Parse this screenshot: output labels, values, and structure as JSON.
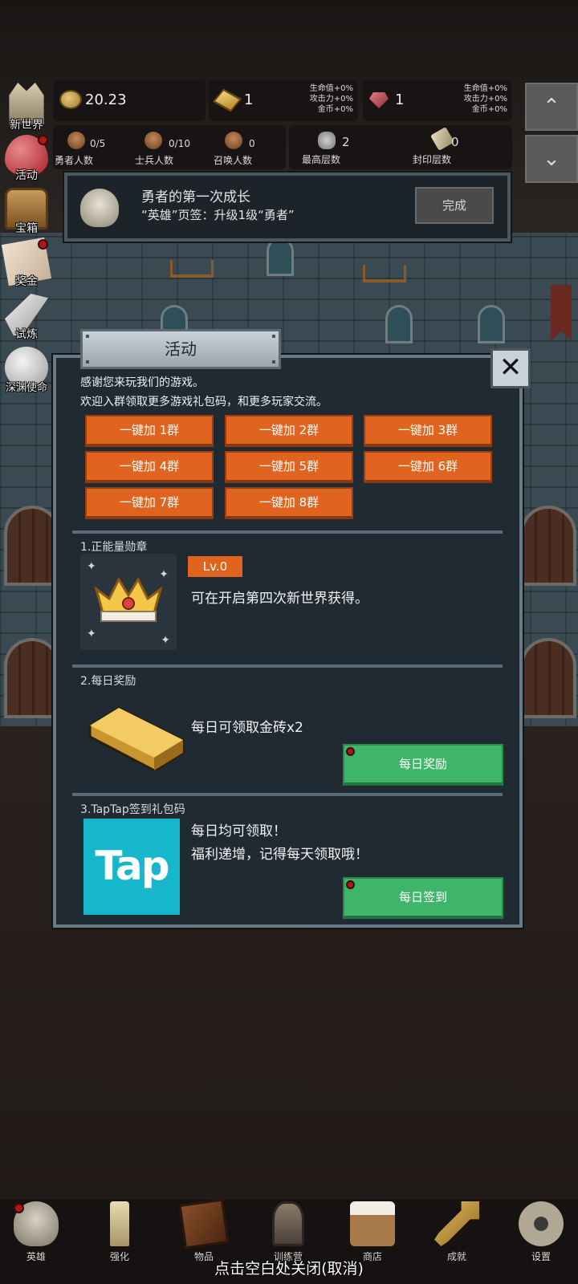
{
  "resources": {
    "gold": "20.23",
    "gold_bars": "1",
    "gems": "1",
    "gold_bars_bonus": [
      "生命值+0%",
      "攻击力+0%",
      "金币+0%"
    ],
    "gems_bonus": [
      "生命值+0%",
      "攻击力+0%",
      "金币+0%"
    ]
  },
  "stats": {
    "heroes": {
      "count": "0/5",
      "label": "勇者人数"
    },
    "soldiers": {
      "count": "0/10",
      "label": "士兵人数"
    },
    "summons": {
      "count": "0",
      "label": "召唤人数"
    },
    "max_floor": {
      "count": "2",
      "label": "最高层数"
    },
    "sealed_floor": {
      "count": "0",
      "label": "封印层数"
    }
  },
  "scroll": {
    "up": "⌃",
    "down": "⌄"
  },
  "left_menu": [
    {
      "label": "新世界",
      "badge": false
    },
    {
      "label": "活动",
      "badge": true
    },
    {
      "label": "宝箱",
      "badge": false
    },
    {
      "label": "奖金",
      "badge": true
    },
    {
      "label": "试炼",
      "badge": false
    },
    {
      "label": "深渊使命",
      "badge": false
    }
  ],
  "quest": {
    "title": "勇者的第一次成长",
    "description": "“英雄”页签：升级1级“勇者”",
    "button": "完成"
  },
  "popup": {
    "title": "活动",
    "close": "✕",
    "intro_line1": "感谢您来玩我们的游戏。",
    "intro_line2": "欢迎入群领取更多游戏礼包码，和更多玩家交流。",
    "group_buttons": [
      "一键加 1群",
      "一键加 2群",
      "一键加 3群",
      "一键加 4群",
      "一键加 5群",
      "一键加 6群",
      "一键加 7群",
      "一键加 8群"
    ],
    "section1": {
      "title": "1.正能量勋章",
      "level": "Lv.0",
      "text": "可在开启第四次新世界获得。"
    },
    "section2": {
      "title": "2.每日奖励",
      "text": "每日可领取金砖x2",
      "button": "每日奖励"
    },
    "section3": {
      "title": "3.TapTap签到礼包码",
      "text_line1": "每日均可领取！",
      "text_line2": "福利递增，记得每天领取哦！",
      "logo_text": "Tap",
      "button": "每日签到"
    }
  },
  "bottom_nav": [
    {
      "label": "英雄",
      "badge": true
    },
    {
      "label": "强化",
      "badge": false
    },
    {
      "label": "物品",
      "badge": false
    },
    {
      "label": "训练营",
      "badge": false
    },
    {
      "label": "商店",
      "badge": false
    },
    {
      "label": "成就",
      "badge": false
    },
    {
      "label": "设置",
      "badge": false
    }
  ],
  "close_hint": "点击空白处关闭(取消)",
  "colors": {
    "orange_button": "#e0641f",
    "green_button": "#3fb56a",
    "panel": "#202a33",
    "badge_red": "#b01818",
    "tap_brand": "#16b6cc"
  }
}
